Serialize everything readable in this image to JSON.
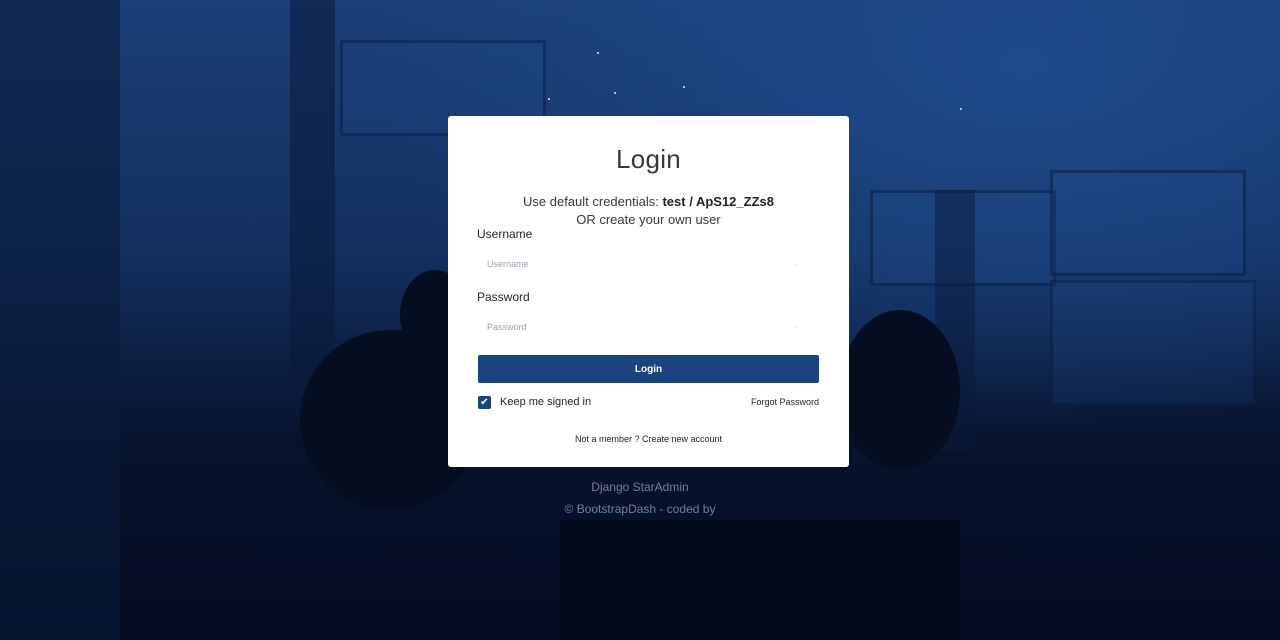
{
  "card": {
    "title": "Login",
    "credentials_prefix": "Use default credentials: ",
    "credentials_value": "test / ApS12_ZZs8",
    "credentials_alt": "OR create your own user",
    "username_label": "Username",
    "username_placeholder": "Username",
    "password_label": "Password",
    "password_placeholder": "Password",
    "login_button": "Login",
    "keep_signed_in": "Keep me signed in",
    "keep_signed_in_checked": true,
    "forgot_password": "Forgot Password",
    "not_member": "Not a member ?",
    "create_account": "Create new account"
  },
  "footer": {
    "line1": "Django StarAdmin",
    "line2": "© BootstrapDash - coded by"
  },
  "colors": {
    "accent": "#1b437e",
    "background_top": "#1b3f78",
    "background_bottom": "#040c22"
  }
}
